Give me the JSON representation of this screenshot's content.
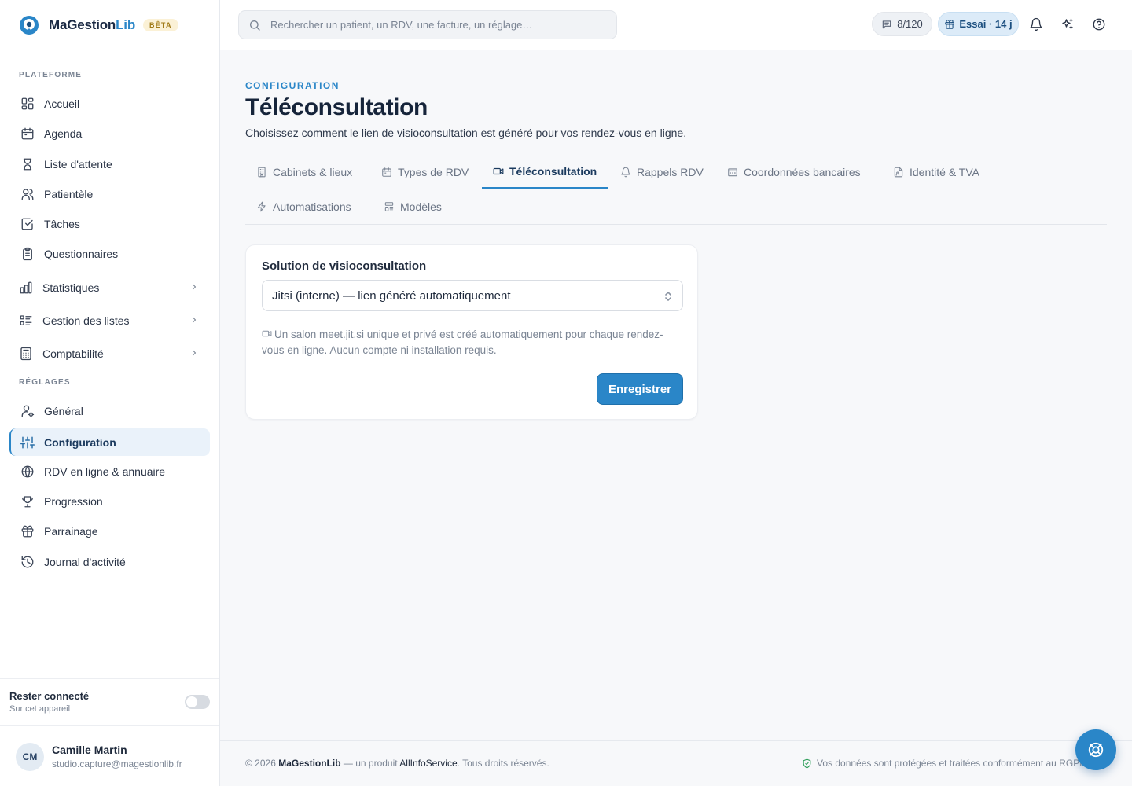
{
  "brand": {
    "name_part1": "MaGestion",
    "name_part2": "Lib",
    "badge": "BÊTA"
  },
  "sidebar": {
    "platform_label": "PLATEFORME",
    "settings_label": "RÉGLAGES",
    "platform_items": [
      {
        "label": "Accueil",
        "icon": "dashboard-icon"
      },
      {
        "label": "Agenda",
        "icon": "calendar-icon"
      },
      {
        "label": "Liste d'attente",
        "icon": "hourglass-icon"
      },
      {
        "label": "Patientèle",
        "icon": "users-icon"
      },
      {
        "label": "Tâches",
        "icon": "check-square-icon"
      },
      {
        "label": "Questionnaires",
        "icon": "clipboard-icon"
      },
      {
        "label": "Statistiques",
        "icon": "bar-chart-icon"
      },
      {
        "label": "Gestion des listes",
        "icon": "list-icon"
      },
      {
        "label": "Comptabilité",
        "icon": "calculator-icon"
      }
    ],
    "settings_items": [
      {
        "label": "Général",
        "icon": "user-settings-icon"
      },
      {
        "label": "Configuration",
        "icon": "sliders-icon",
        "active": true
      },
      {
        "label": "RDV en ligne & annuaire",
        "icon": "globe-icon"
      },
      {
        "label": "Progression",
        "icon": "trophy-icon"
      },
      {
        "label": "Parrainage",
        "icon": "gift-icon"
      },
      {
        "label": "Journal d'activité",
        "icon": "history-icon"
      }
    ],
    "stay_connected": {
      "title": "Rester connecté",
      "subtitle": "Sur cet appareil",
      "enabled": false
    },
    "user": {
      "initials": "CM",
      "name": "Camille Martin",
      "email": "studio.capture@magestionlib.fr"
    }
  },
  "topbar": {
    "search_placeholder": "Rechercher un patient, un RDV, une facture, un réglage…",
    "counter": "8/120",
    "trial": "Essai · 14 j",
    "icons": [
      "bell-icon",
      "sparkles-icon",
      "help-circle-icon"
    ]
  },
  "page": {
    "eyebrow": "CONFIGURATION",
    "title": "Téléconsultation",
    "subtitle": "Choisissez comment le lien de visioconsultation est généré pour vos rendez-vous en ligne.",
    "tabs": [
      {
        "label": "Cabinets & lieux",
        "icon": "building-icon"
      },
      {
        "label": "Types de RDV",
        "icon": "calendar-icon"
      },
      {
        "label": "Téléconsultation",
        "icon": "video-icon",
        "active": true
      },
      {
        "label": "Rappels RDV",
        "icon": "bell-icon"
      },
      {
        "label": "Coordonnées bancaires",
        "icon": "bank-icon"
      },
      {
        "label": "Identité & TVA",
        "icon": "file-id-icon"
      },
      {
        "label": "Automatisations",
        "icon": "zap-icon"
      },
      {
        "label": "Modèles",
        "icon": "template-icon"
      }
    ]
  },
  "card": {
    "label": "Solution de visioconsultation",
    "selected": "Jitsi (interne) — lien généré automatiquement",
    "help": "Un salon meet.jit.si unique et privé est créé automatiquement pour chaque rendez-vous en ligne. Aucun compte ni installation requis.",
    "save": "Enregistrer"
  },
  "footer": {
    "prefix": "© 2026 ",
    "brand": "MaGestionLib",
    "middle": " — un produit ",
    "company": "AllInfoService",
    "suffix": ". Tous droits réservés.",
    "right": "Vos données sont protégées et traitées conformément au RGPD."
  },
  "colors": {
    "accent": "#2a86c8",
    "active_bg": "#eaf2fa",
    "beta_bg": "#fbf1d6"
  }
}
